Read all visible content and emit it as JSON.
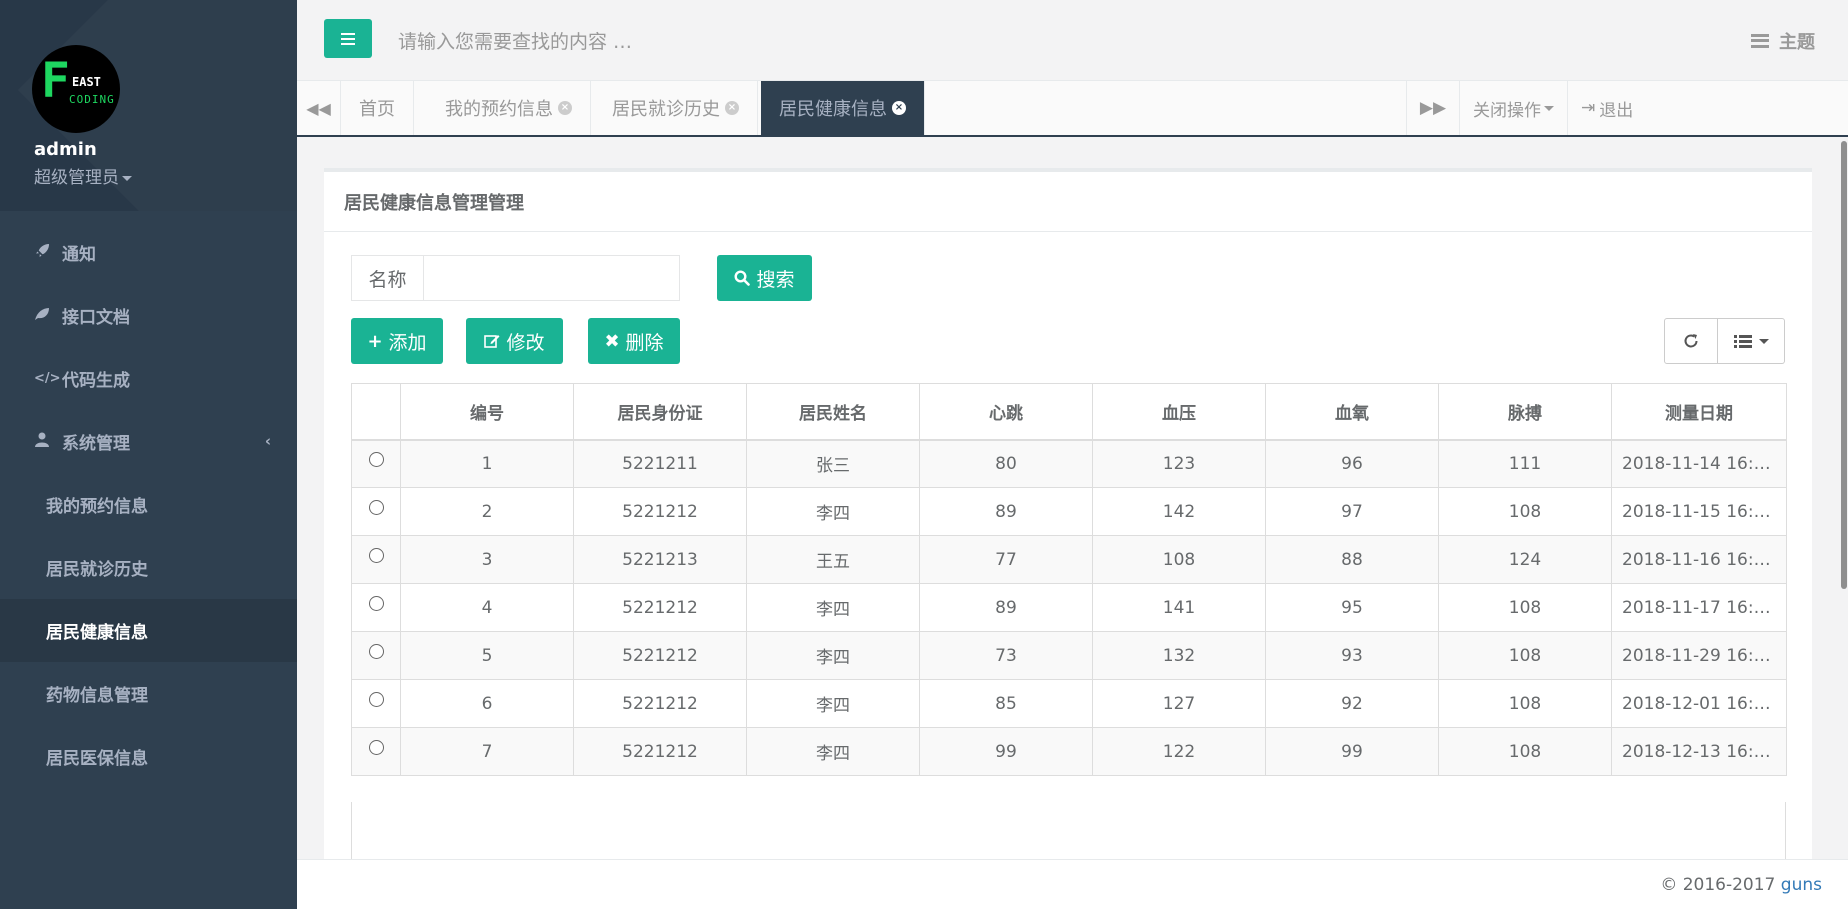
{
  "sidebar": {
    "logo": {
      "letter": "F",
      "line1": "EAST",
      "line2": "CODING"
    },
    "user": {
      "name": "admin",
      "role": "超级管理员"
    },
    "items": [
      {
        "label": "通知",
        "icon": "rocket-icon"
      },
      {
        "label": "接口文档",
        "icon": "leaf-icon"
      },
      {
        "label": "代码生成",
        "icon": "code-icon"
      },
      {
        "label": "系统管理",
        "icon": "user-icon"
      },
      {
        "label": "我的预约信息"
      },
      {
        "label": "居民就诊历史"
      },
      {
        "label": "居民健康信息",
        "active": true
      },
      {
        "label": "药物信息管理"
      },
      {
        "label": "居民医保信息"
      }
    ]
  },
  "topbar": {
    "search_placeholder": "请输入您需要查找的内容 …",
    "theme_label": "主题"
  },
  "tabs": {
    "items": [
      {
        "label": "首页"
      },
      {
        "label": "我的预约信息"
      },
      {
        "label": "居民就诊历史"
      },
      {
        "label": "居民健康信息",
        "active": true
      }
    ],
    "close_ops": "关闭操作",
    "logout": "退出"
  },
  "main": {
    "title": "居民健康信息管理管理",
    "search": {
      "label": "名称",
      "value": "",
      "button": "搜索"
    },
    "buttons": {
      "add": "添加",
      "edit": "修改",
      "delete": "删除"
    },
    "table": {
      "columns": [
        "",
        "编号",
        "居民身份证",
        "居民姓名",
        "心跳",
        "血压",
        "血氧",
        "脉搏",
        "测量日期"
      ],
      "rows": [
        [
          "1",
          "5221211",
          "张三",
          "80",
          "123",
          "96",
          "111",
          "2018-11-14 16:3..."
        ],
        [
          "2",
          "5221212",
          "李四",
          "89",
          "142",
          "97",
          "108",
          "2018-11-15 16:4..."
        ],
        [
          "3",
          "5221213",
          "王五",
          "77",
          "108",
          "88",
          "124",
          "2018-11-16 16:4..."
        ],
        [
          "4",
          "5221212",
          "李四",
          "89",
          "141",
          "95",
          "108",
          "2018-11-17 16:4..."
        ],
        [
          "5",
          "5221212",
          "李四",
          "73",
          "132",
          "93",
          "108",
          "2018-11-29 16:4..."
        ],
        [
          "6",
          "5221212",
          "李四",
          "85",
          "127",
          "92",
          "108",
          "2018-12-01 16:4..."
        ],
        [
          "7",
          "5221212",
          "李四",
          "99",
          "122",
          "99",
          "108",
          "2018-12-13 16:4..."
        ]
      ]
    }
  },
  "footer": {
    "copyright": "© 2016-2017 ",
    "link": "guns"
  },
  "colors": {
    "accent": "#1ab394",
    "sidebar": "#2f4050",
    "link": "#337ab7"
  }
}
